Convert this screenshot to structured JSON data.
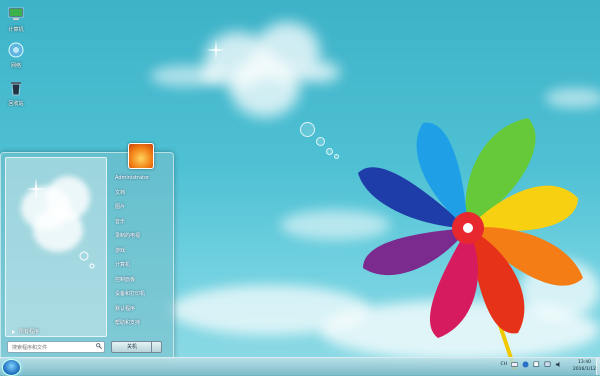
{
  "desktop": {
    "icons": [
      {
        "name": "computer-icon",
        "label": "计算机"
      },
      {
        "name": "network-icon",
        "label": "网络"
      },
      {
        "name": "recycle-bin-icon",
        "label": "回收站"
      }
    ]
  },
  "start_menu": {
    "all_programs": "所有程序",
    "search_placeholder": "搜索程序和文件",
    "shutdown_label": "关机",
    "right_items": [
      {
        "id": "administrator",
        "label": "Administrator"
      },
      {
        "id": "documents",
        "label": "文档"
      },
      {
        "id": "pictures",
        "label": "图片"
      },
      {
        "id": "music",
        "label": "音乐"
      },
      {
        "id": "recorded-tv",
        "label": "录制的电视"
      },
      {
        "id": "games",
        "label": "游戏"
      },
      {
        "id": "computer",
        "label": "计算机"
      },
      {
        "id": "control-panel",
        "label": "控制面板"
      },
      {
        "id": "devices-printers",
        "label": "设备和打印机"
      },
      {
        "id": "default-programs",
        "label": "默认程序"
      },
      {
        "id": "help-support",
        "label": "帮助和支持"
      }
    ]
  },
  "taskbar": {
    "time": "13:40",
    "date": "2016/1/12",
    "tray_label": "CH"
  },
  "colors": {
    "sky": "#4fc1d4",
    "start_orb": "#1767b8"
  }
}
